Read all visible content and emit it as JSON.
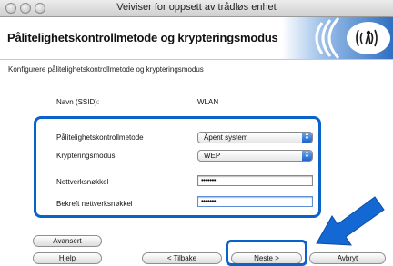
{
  "window": {
    "title": "Veiviser for oppsett av trådløs enhet"
  },
  "header": {
    "title": "Pålitelighetskontrollmetode og krypteringsmodus",
    "logo_icon": "wireless-signal-icon"
  },
  "subtitle": "Konfigurere pålitelighetskontrollmetode og krypteringsmodus",
  "ssid": {
    "label": "Navn (SSID):",
    "value": "WLAN"
  },
  "form": {
    "auth_label": "Pålitelighetskontrollmetode",
    "auth_value": "Åpent system",
    "enc_label": "Krypteringsmodus",
    "enc_value": "WEP",
    "key_label": "Nettverksnøkkel",
    "key_value": "•••••••",
    "confirm_label": "Bekreft nettverksnøkkel",
    "confirm_value": "•••••••"
  },
  "buttons": {
    "advanced": "Avansert",
    "help": "Hjelp",
    "back": "< Tilbake",
    "next": "Neste >",
    "cancel": "Avbryt"
  },
  "colors": {
    "highlight": "#0a63c8",
    "accent_blue": "#1f63c9"
  }
}
